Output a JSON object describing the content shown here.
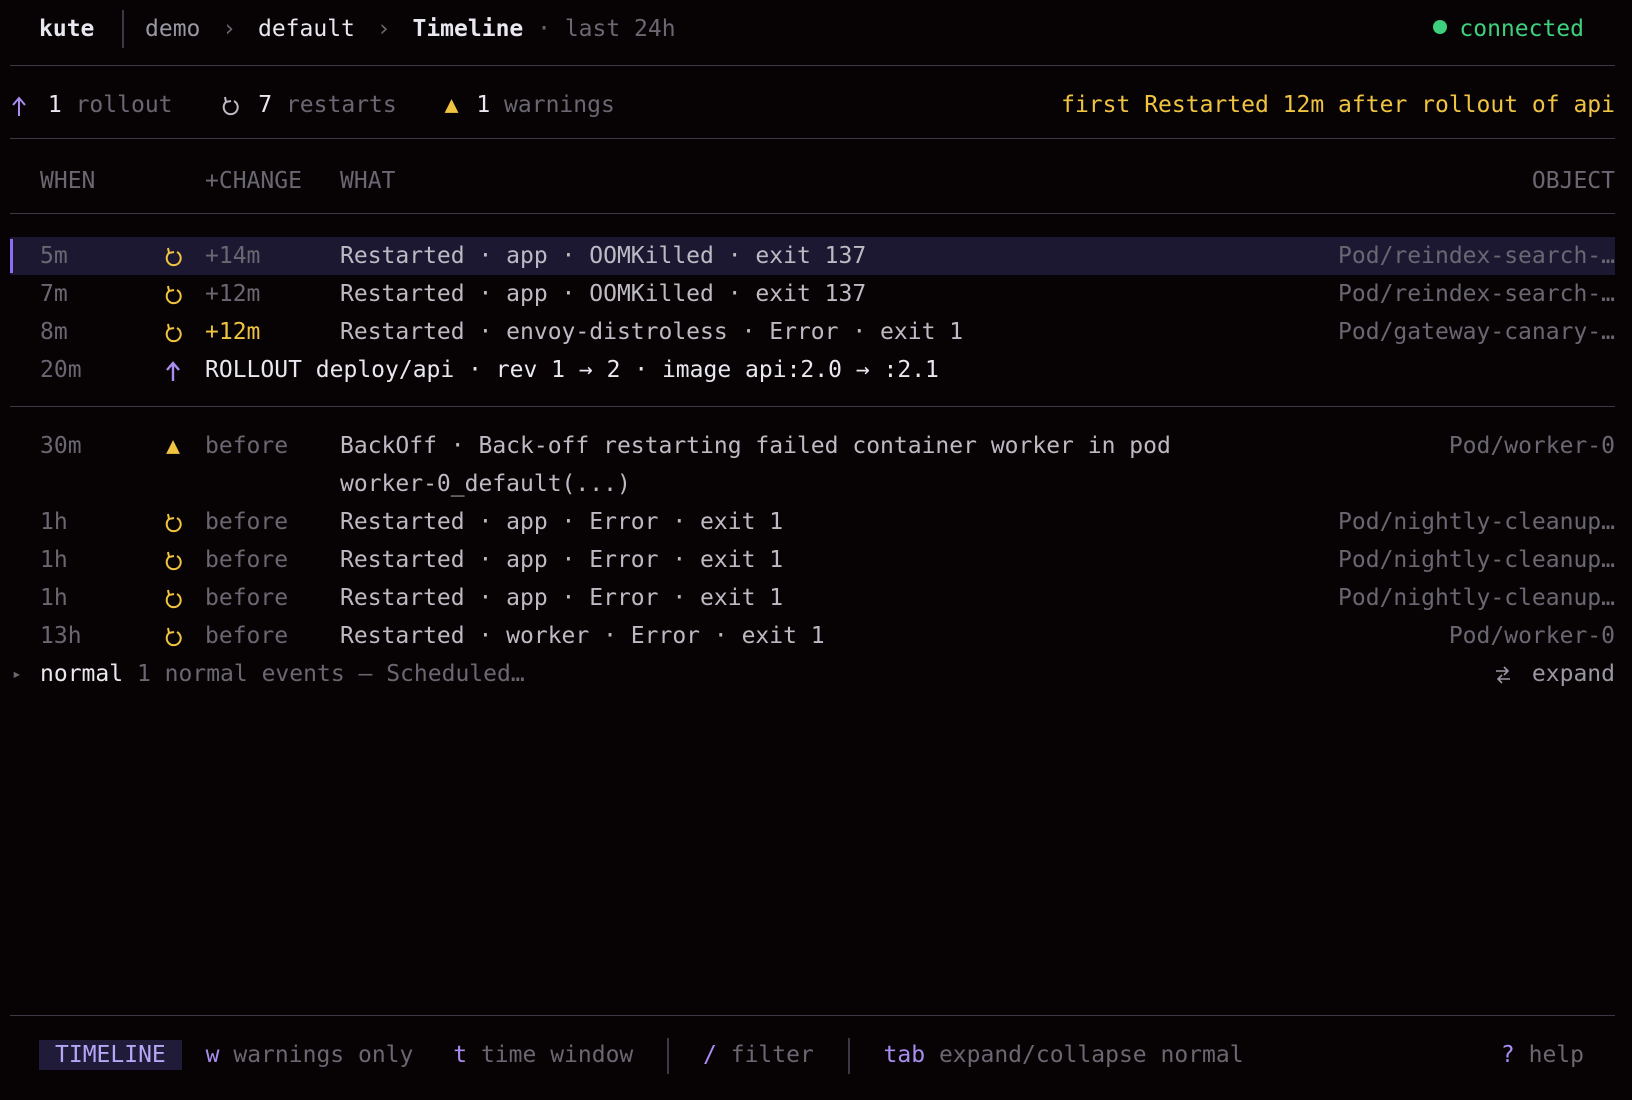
{
  "header": {
    "app": "kute",
    "crumbs": [
      "demo",
      "default"
    ],
    "crumb_sep": "›",
    "view": "Timeline",
    "range": "· last 24h",
    "status": "connected",
    "status_color": "#3ed07c"
  },
  "summary": {
    "rollouts_count": "1",
    "rollouts_label": "rollout",
    "restarts_count": "7",
    "restarts_label": "restarts",
    "warnings_count": "1",
    "warnings_label": "warnings",
    "insight": "first Restarted 12m after rollout of api"
  },
  "columns": {
    "when": "WHEN",
    "change": "+CHANGE",
    "what": "WHAT",
    "object": "OBJECT"
  },
  "after_rows": [
    {
      "when": "5m",
      "icon": "restart-icon",
      "change": "+14m",
      "what": "Restarted · app · OOMKilled · exit 137",
      "object": "Pod/reindex-search-…"
    },
    {
      "when": "7m",
      "icon": "restart-icon",
      "change": "+12m",
      "what": "Restarted · app · OOMKilled · exit 137",
      "object": "Pod/reindex-search-…"
    },
    {
      "when": "8m",
      "icon": "restart-icon",
      "change": "+12m",
      "what": "Restarted · envoy-distroless · Error · exit 1",
      "object": "Pod/gateway-canary-…"
    }
  ],
  "rollout_row": {
    "when": "20m",
    "icon": "rollout-arrow-icon",
    "what": "ROLLOUT deploy/api · rev 1 → 2 · image api:2.0 → :2.1"
  },
  "before_rows": [
    {
      "when": "30m",
      "icon": "warning-icon",
      "change": "before",
      "what": "BackOff · Back-off restarting failed container worker in pod",
      "what_cont": "worker-0_default(...)",
      "object": "Pod/worker-0"
    },
    {
      "when": "1h",
      "icon": "restart-icon",
      "change": "before",
      "what": "Restarted · app · Error · exit 1",
      "object": "Pod/nightly-cleanup…"
    },
    {
      "when": "1h",
      "icon": "restart-icon",
      "change": "before",
      "what": "Restarted · app · Error · exit 1",
      "object": "Pod/nightly-cleanup…"
    },
    {
      "when": "1h",
      "icon": "restart-icon",
      "change": "before",
      "what": "Restarted · app · Error · exit 1",
      "object": "Pod/nightly-cleanup…"
    },
    {
      "when": "13h",
      "icon": "restart-icon",
      "change": "before",
      "what": "Restarted · worker · Error · exit 1",
      "object": "Pod/worker-0"
    }
  ],
  "normal_group": {
    "marker": "▸",
    "label": "normal",
    "summary": "1 normal events — Scheduled…",
    "expand_label": "expand"
  },
  "footer": {
    "mode": "TIMELINE",
    "keys": [
      {
        "key": "w",
        "label": "warnings only"
      },
      {
        "key": "t",
        "label": "time window"
      },
      {
        "key": "/",
        "label": "filter"
      },
      {
        "key": "tab",
        "label": "expand/collapse normal"
      }
    ],
    "help_key": "?",
    "help_label": "help"
  },
  "colors": {
    "accent": "#a98df0",
    "warning": "#f0c441",
    "background": "#070304"
  }
}
